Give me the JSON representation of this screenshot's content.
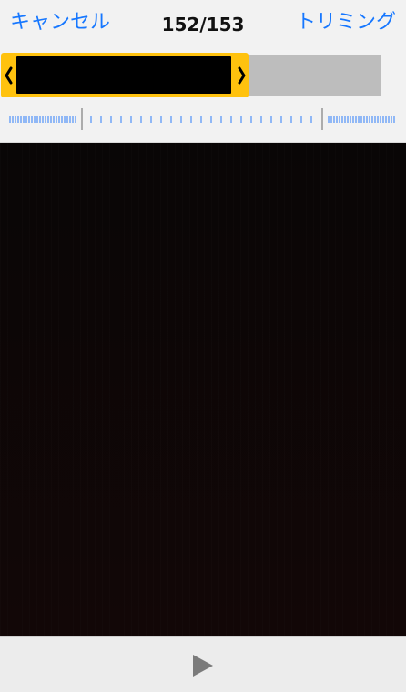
{
  "header": {
    "cancel_label": "キャンセル",
    "counter": "152/153",
    "trim_label": "トリミング"
  },
  "icons": {
    "left_handle": "chevron-left-icon",
    "right_handle": "chevron-right-icon",
    "play": "play-icon"
  },
  "colors": {
    "accent_blue": "#1677ff",
    "trim_yellow": "#ffc20e"
  }
}
